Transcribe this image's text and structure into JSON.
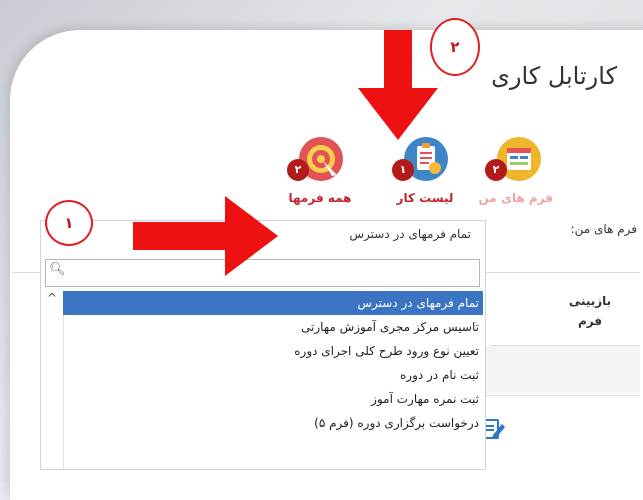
{
  "page": {
    "title": "کارتابل کاری"
  },
  "tiles": [
    {
      "key": "all_forms",
      "label": "همه فرمها",
      "badge": "۲",
      "label_color": "#c0262d",
      "circle_color": "#e35355"
    },
    {
      "key": "work_list",
      "label": "لیست کار",
      "badge": "۱",
      "label_color": "#c0262d",
      "circle_color": "#3e86c7"
    },
    {
      "key": "my_forms",
      "label": "فرم های من",
      "badge": "۲",
      "label_color": "#f0a3a3",
      "circle_color": "#efb52b"
    }
  ],
  "filter": {
    "label": "فرم های من:",
    "selected": "تمام فرمهای در دسترس",
    "search_placeholder": ""
  },
  "dropdown_items": [
    "تمام فرمهای در دسترس",
    "تاسیس مرکز مجری آموزش مهارتی",
    "تعیین نوع ورود طرح کلی اجرای دوره",
    "ثبت نام در دوره",
    "ثبت نمره مهارت آموز",
    "درخواست برگزاری دوره (فرم ۵)"
  ],
  "table": {
    "header": "بازبینی فرم"
  },
  "annotations": {
    "one": "۱",
    "two": "۲"
  },
  "colors": {
    "accent": "#3c74c4",
    "badge": "#b31b1b",
    "arrow": "#ee1111"
  }
}
